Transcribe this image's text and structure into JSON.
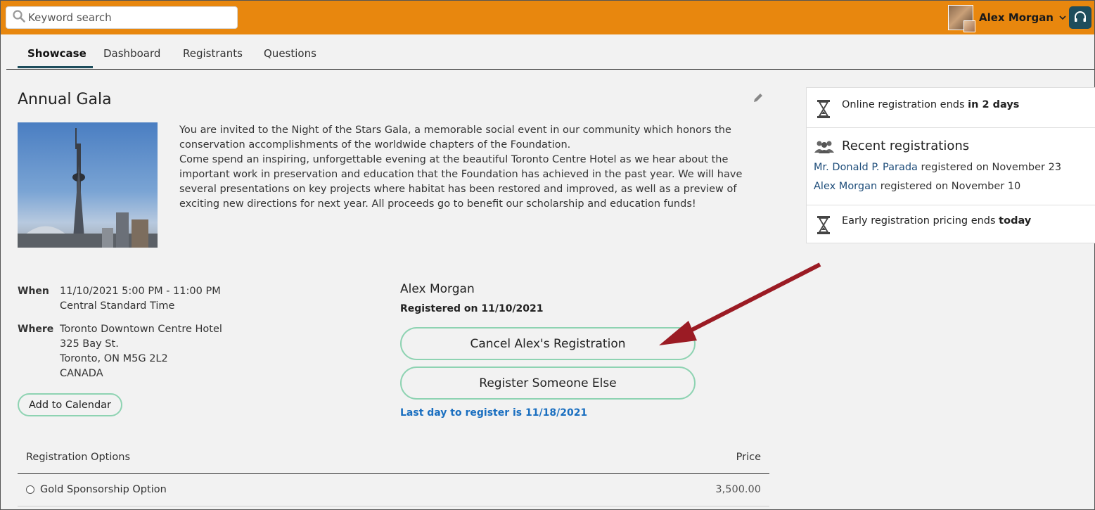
{
  "header": {
    "search_placeholder": "Keyword search",
    "user_name": "Alex Morgan",
    "accent_color": "#e8870e"
  },
  "tabs": [
    {
      "label": "Showcase",
      "active": true
    },
    {
      "label": "Dashboard",
      "active": false
    },
    {
      "label": "Registrants",
      "active": false
    },
    {
      "label": "Questions",
      "active": false
    }
  ],
  "event": {
    "title": "Annual Gala",
    "description_1": "You are invited to the Night of the Stars Gala, a memorable social event in our community which honors the conservation accomplishments of the worldwide chapters of the Foundation.",
    "description_2": "Come spend an inspiring, unforgettable evening at the beautiful Toronto Centre Hotel as we hear about the important work in preservation and education that the Foundation has achieved in the past year. We will have several presentations on key projects where habitat has been restored and improved, as well as a preview  of exciting new directions for next year. All proceeds go to benefit our scholarship and education funds!",
    "when_label": "When",
    "when_line1": "11/10/2021 5:00 PM - 11:00 PM",
    "when_line2": "Central Standard Time",
    "where_label": "Where",
    "where_line1": "Toronto Downtown Centre Hotel",
    "where_line2": "325 Bay St.",
    "where_line3": "Toronto, ON M5G 2L2",
    "where_line4": "CANADA",
    "add_calendar": "Add to Calendar"
  },
  "registration": {
    "name": "Alex Morgan",
    "registered_on": "Registered on 11/10/2021",
    "cancel_button": "Cancel Alex's Registration",
    "register_other_button": "Register Someone Else",
    "last_day": "Last day to register is 11/18/2021"
  },
  "options_table": {
    "col_option": "Registration Options",
    "col_price": "Price",
    "rows": [
      {
        "label": "Gold Sponsorship Option",
        "price": "3,500.00"
      }
    ]
  },
  "side_panel": {
    "online_ends_text": "Online registration ends ",
    "online_ends_bold": "in 2 days",
    "recent_heading": "Recent registrations",
    "recent": [
      {
        "name": "Mr. Donald P. Parada",
        "text": " registered on November 23"
      },
      {
        "name": "Alex Morgan",
        "text": " registered on November 10"
      }
    ],
    "early_text": "Early registration pricing ends ",
    "early_bold": "today"
  }
}
